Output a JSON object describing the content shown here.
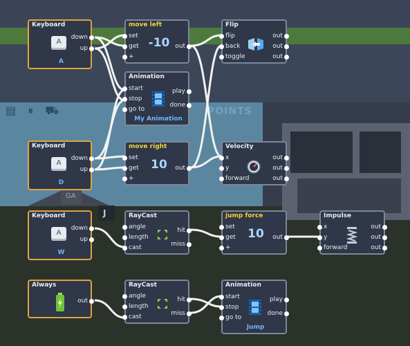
{
  "colors": {
    "wire": "#f2f2f2",
    "title_yellow": "#f2d23a",
    "sub_blue": "#6fb6ff",
    "trigger_border": "#e0a43e",
    "node_border": "#7d879c",
    "node_bg": "#2f3748"
  },
  "scene": {
    "score_text": "POINTS",
    "tree_label": "J",
    "shop_sign": "GA"
  },
  "nodes": {
    "kb_a": {
      "title": "Keyboard",
      "key": "A",
      "sub": "A",
      "ports": [
        "down",
        "up"
      ]
    },
    "kb_d": {
      "title": "Keyboard",
      "key": "A",
      "sub": "D",
      "ports": [
        "down",
        "up"
      ]
    },
    "kb_w": {
      "title": "Keyboard",
      "key": "A",
      "sub": "W",
      "ports": [
        "down",
        "up"
      ]
    },
    "always": {
      "title": "Always",
      "port": "out",
      "icon": "battery-icon"
    },
    "move_left": {
      "title": "move left",
      "inputs": [
        "set",
        "get",
        "+"
      ],
      "output": "out",
      "value": "-10"
    },
    "move_right": {
      "title": "move right",
      "inputs": [
        "set",
        "get",
        "+"
      ],
      "output": "out",
      "value": "10"
    },
    "jump_force": {
      "title": "jump force",
      "inputs": [
        "set",
        "get",
        "+"
      ],
      "output": "out",
      "value": "10"
    },
    "anim1": {
      "title": "Animation",
      "inputs": [
        "start",
        "stop",
        "go to"
      ],
      "outputs": [
        "play",
        "done"
      ],
      "sub": "My Animation"
    },
    "anim2": {
      "title": "Animation",
      "inputs": [
        "start",
        "stop",
        "go to"
      ],
      "outputs": [
        "play",
        "done"
      ],
      "sub": "Jump"
    },
    "flip": {
      "title": "Flip",
      "inputs": [
        "flip",
        "back",
        "toggle"
      ],
      "outputs": [
        "out",
        "out",
        "out"
      ]
    },
    "velocity": {
      "title": "Velocity",
      "inputs": [
        "x",
        "y",
        "forward"
      ],
      "outputs": [
        "out",
        "out",
        "out"
      ]
    },
    "impulse": {
      "title": "Impulse",
      "inputs": [
        "x",
        "y",
        "forward"
      ],
      "outputs": [
        "out",
        "out",
        "out"
      ]
    },
    "raycast1": {
      "title": "RayCast",
      "inputs": [
        "angle",
        "length",
        "cast"
      ],
      "outputs": [
        "hit",
        "miss"
      ]
    },
    "raycast2": {
      "title": "RayCast",
      "inputs": [
        "angle",
        "length",
        "cast"
      ],
      "outputs": [
        "hit",
        "miss"
      ]
    }
  }
}
